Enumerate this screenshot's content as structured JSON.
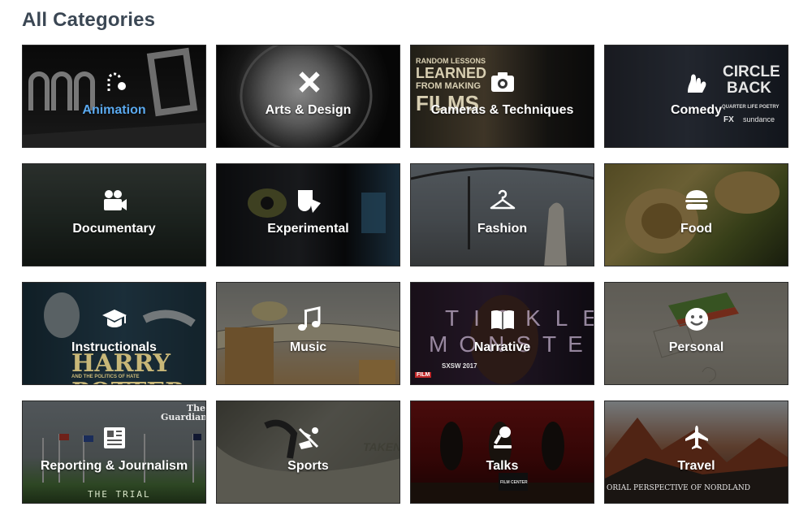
{
  "page": {
    "title": "All Categories"
  },
  "categories": [
    {
      "label": "Animation",
      "icon": "anchor-hook-icon",
      "active": true
    },
    {
      "label": "Arts & Design",
      "icon": "pencil-ruler-icon"
    },
    {
      "label": "Cameras & Techniques",
      "icon": "camera-icon",
      "overlay": [
        "RANDOM LESSONS",
        "LEARNED",
        "FROM MAKING",
        "FILMS"
      ]
    },
    {
      "label": "Comedy",
      "icon": "hand-drawn-icon",
      "overlay": [
        "CIRCLE",
        "BACK",
        "QUARTER LIFE POETRY",
        "FX",
        "sundance"
      ]
    },
    {
      "label": "Documentary",
      "icon": "video-camera-icon"
    },
    {
      "label": "Experimental",
      "icon": "shapes-icon"
    },
    {
      "label": "Fashion",
      "icon": "hanger-icon"
    },
    {
      "label": "Food",
      "icon": "burger-icon"
    },
    {
      "label": "Instructionals",
      "icon": "graduation-cap-icon",
      "overlay": [
        "HARRY POTTER",
        "AND THE POLITICS OF HATE"
      ]
    },
    {
      "label": "Music",
      "icon": "music-note-icon"
    },
    {
      "label": "Narrative",
      "icon": "open-book-icon",
      "overlay": [
        "TICKLE",
        "MONSTER",
        "SXSW 2017",
        "FILM"
      ]
    },
    {
      "label": "Personal",
      "icon": "smiley-icon"
    },
    {
      "label": "Reporting & Journalism",
      "icon": "newspaper-icon",
      "overlay": [
        "The Guardian",
        "THE TRIAL"
      ]
    },
    {
      "label": "Sports",
      "icon": "sports-icon",
      "overlay": [
        "TAKEN"
      ]
    },
    {
      "label": "Talks",
      "icon": "microphone-icon",
      "overlay": [
        "FILM CENTER"
      ]
    },
    {
      "label": "Travel",
      "icon": "airplane-icon",
      "overlay": [
        "ORIAL PERSPECTIVE OF NORDLAND"
      ]
    }
  ]
}
